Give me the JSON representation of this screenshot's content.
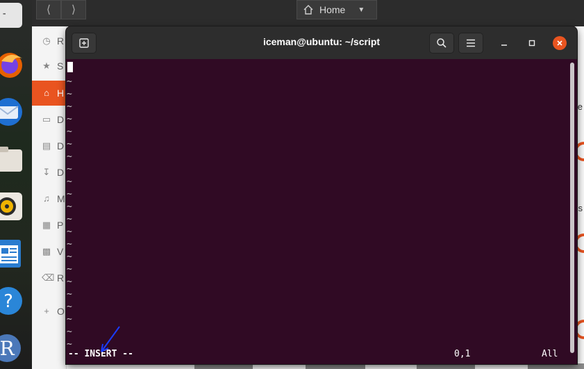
{
  "dock": {
    "top_app_label": "-"
  },
  "file_manager": {
    "path_label": "Home",
    "sidebar": [
      {
        "label": "Recent",
        "icon": "clock-icon",
        "short": "R"
      },
      {
        "label": "Starred",
        "icon": "star-icon",
        "short": "S"
      },
      {
        "label": "Home",
        "icon": "home-icon",
        "short": "H"
      },
      {
        "label": "Desktop",
        "icon": "desktop-icon",
        "short": "D"
      },
      {
        "label": "Documents",
        "icon": "document-icon",
        "short": "D"
      },
      {
        "label": "Downloads",
        "icon": "download-icon",
        "short": "D"
      },
      {
        "label": "Music",
        "icon": "music-icon",
        "short": "M"
      },
      {
        "label": "Pictures",
        "icon": "picture-icon",
        "short": "P"
      },
      {
        "label": "Videos",
        "icon": "video-icon",
        "short": "V"
      },
      {
        "label": "Rubbish Bin",
        "icon": "trash-icon",
        "short": "R"
      },
      {
        "label": "Other Locations",
        "icon": "plus-icon",
        "short": "O"
      }
    ],
    "partial_labels": [
      "e",
      "s"
    ]
  },
  "terminal": {
    "title": "iceman@ubuntu: ~/script",
    "tilde": "~",
    "mode": "-- INSERT --",
    "cursor_position": "0,1",
    "scroll_position": "All"
  },
  "colors": {
    "terminal_bg": "#300a24",
    "accent": "#e95420",
    "titlebar": "#2d2d2d"
  }
}
